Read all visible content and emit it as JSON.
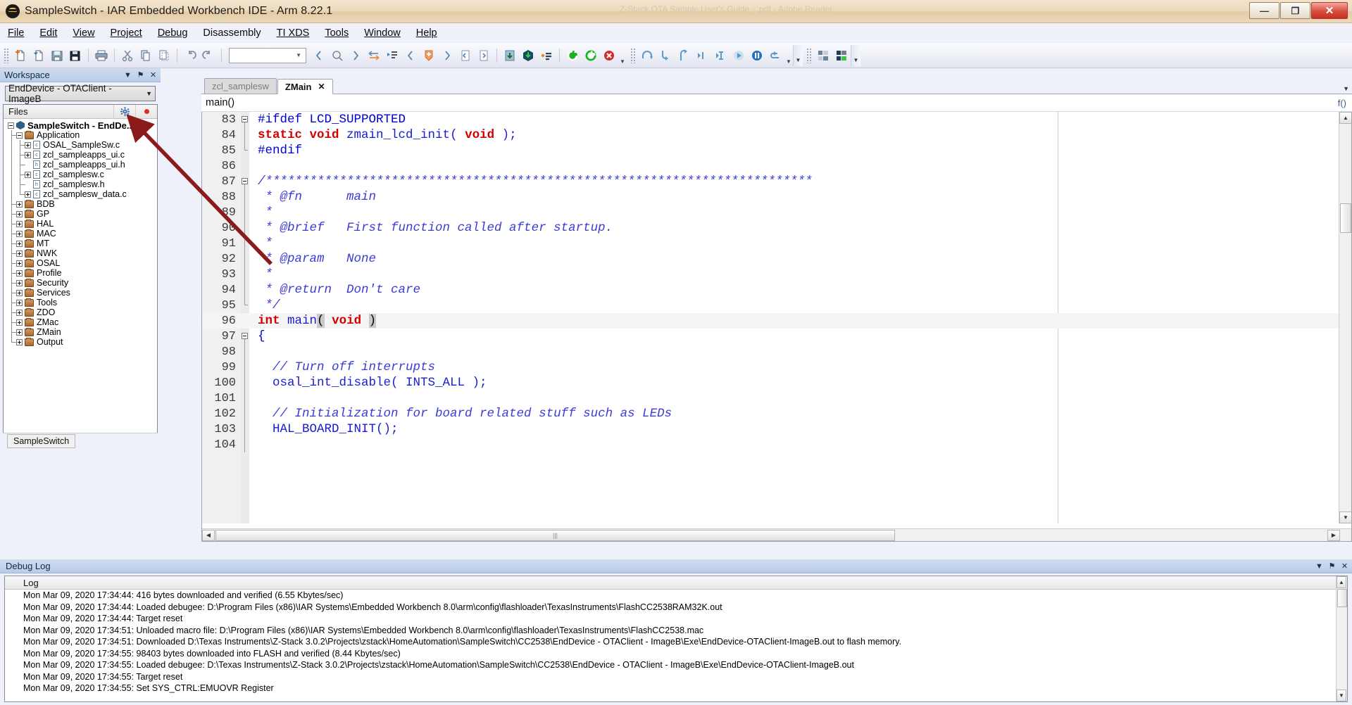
{
  "window": {
    "title": "SampleSwitch - IAR Embedded Workbench IDE - Arm 8.22.1",
    "ghost_title": "Z-Stack OTA Sample User's Guide - .pdf - Adobe Reader",
    "app_icon": "iar-logo-icon",
    "controls": {
      "minimize": "—",
      "maximize": "❐",
      "close": "✕"
    }
  },
  "menubar": {
    "items": [
      {
        "label": "File"
      },
      {
        "label": "Edit"
      },
      {
        "label": "View"
      },
      {
        "label": "Project"
      },
      {
        "label": "Debug"
      },
      {
        "label": "Disassembly"
      },
      {
        "label": "TI XDS"
      },
      {
        "label": "Tools"
      },
      {
        "label": "Window"
      },
      {
        "label": "Help"
      }
    ]
  },
  "toolbar": {
    "combo_value": "",
    "buttons": [
      {
        "name": "new-document-icon"
      },
      {
        "name": "open-document-icon"
      },
      {
        "name": "save-icon"
      },
      {
        "name": "save-all-icon"
      },
      {
        "name": "print-icon"
      },
      {
        "name": "cut-icon"
      },
      {
        "name": "copy-icon"
      },
      {
        "name": "paste-icon"
      },
      {
        "name": "undo-icon"
      },
      {
        "name": "redo-icon"
      },
      {
        "name": "navigate-back-icon"
      },
      {
        "name": "find-icon"
      },
      {
        "name": "navigate-forward-icon"
      },
      {
        "name": "go-to-definition-icon"
      },
      {
        "name": "bookmark-list-icon"
      },
      {
        "name": "previous-bookmark-icon"
      },
      {
        "name": "toggle-bookmark-icon"
      },
      {
        "name": "next-bookmark-icon"
      },
      {
        "name": "compile-icon"
      },
      {
        "name": "make-icon"
      },
      {
        "name": "download-and-debug-icon"
      },
      {
        "name": "debug-without-download-icon"
      },
      {
        "name": "make-and-restart-debugger-icon"
      },
      {
        "name": "reset-icon"
      },
      {
        "name": "stop-debugging-icon"
      },
      {
        "name": "step-over-icon"
      },
      {
        "name": "step-into-icon"
      },
      {
        "name": "step-out-icon"
      },
      {
        "name": "next-statement-icon"
      },
      {
        "name": "run-to-cursor-icon"
      },
      {
        "name": "go-icon"
      },
      {
        "name": "break-icon"
      },
      {
        "name": "reset-target-icon"
      },
      {
        "name": "workspace-layout-icon"
      },
      {
        "name": "workspace-save-layout-icon"
      }
    ]
  },
  "workspace": {
    "title": "Workspace",
    "controls": {
      "dropdown": "▼",
      "pin": "⚑",
      "close": "✕"
    },
    "config": {
      "value": "EndDevice - OTAClient - ImageB",
      "arrow": "▼"
    },
    "files_column": "Files",
    "gear_icon": "gear-icon",
    "dot_icon": "red-dot-icon",
    "status_tab": "SampleSwitch",
    "tree": [
      {
        "label": "SampleSwitch - EndDe...",
        "depth": 0,
        "icon": "project-icon",
        "expander": "minus",
        "bold": true
      },
      {
        "label": "Application",
        "depth": 1,
        "icon": "folder-icon",
        "expander": "minus",
        "bold": false
      },
      {
        "label": "OSAL_SampleSw.c",
        "depth": 2,
        "icon": "c-file-icon",
        "expander": "plus",
        "bold": false
      },
      {
        "label": "zcl_sampleapps_ui.c",
        "depth": 2,
        "icon": "c-file-icon",
        "expander": "plus",
        "bold": false
      },
      {
        "label": "zcl_sampleapps_ui.h",
        "depth": 2,
        "icon": "h-file-icon",
        "expander": "none",
        "bold": false
      },
      {
        "label": "zcl_samplesw.c",
        "depth": 2,
        "icon": "c-file-icon",
        "expander": "plus",
        "bold": false
      },
      {
        "label": "zcl_samplesw.h",
        "depth": 2,
        "icon": "h-file-icon",
        "expander": "none",
        "bold": false
      },
      {
        "label": "zcl_samplesw_data.c",
        "depth": 2,
        "icon": "c-file-icon",
        "expander": "plus",
        "bold": false,
        "last": true
      },
      {
        "label": "BDB",
        "depth": 1,
        "icon": "folder-icon",
        "expander": "plus",
        "bold": false
      },
      {
        "label": "GP",
        "depth": 1,
        "icon": "folder-icon",
        "expander": "plus",
        "bold": false
      },
      {
        "label": "HAL",
        "depth": 1,
        "icon": "folder-icon",
        "expander": "plus",
        "bold": false
      },
      {
        "label": "MAC",
        "depth": 1,
        "icon": "folder-icon",
        "expander": "plus",
        "bold": false
      },
      {
        "label": "MT",
        "depth": 1,
        "icon": "folder-icon",
        "expander": "plus",
        "bold": false
      },
      {
        "label": "NWK",
        "depth": 1,
        "icon": "folder-icon",
        "expander": "plus",
        "bold": false
      },
      {
        "label": "OSAL",
        "depth": 1,
        "icon": "folder-icon",
        "expander": "plus",
        "bold": false
      },
      {
        "label": "Profile",
        "depth": 1,
        "icon": "folder-icon",
        "expander": "plus",
        "bold": false
      },
      {
        "label": "Security",
        "depth": 1,
        "icon": "folder-icon",
        "expander": "plus",
        "bold": false
      },
      {
        "label": "Services",
        "depth": 1,
        "icon": "folder-icon",
        "expander": "plus",
        "bold": false
      },
      {
        "label": "Tools",
        "depth": 1,
        "icon": "folder-icon",
        "expander": "plus",
        "bold": false
      },
      {
        "label": "ZDO",
        "depth": 1,
        "icon": "folder-icon",
        "expander": "plus",
        "bold": false
      },
      {
        "label": "ZMac",
        "depth": 1,
        "icon": "folder-icon",
        "expander": "plus",
        "bold": false
      },
      {
        "label": "ZMain",
        "depth": 1,
        "icon": "folder-icon",
        "expander": "plus",
        "bold": false
      },
      {
        "label": "Output",
        "depth": 1,
        "icon": "folder-icon",
        "expander": "plus",
        "bold": false,
        "last": true
      }
    ]
  },
  "editor": {
    "tabs": [
      {
        "label": "zcl_samplesw",
        "active": false,
        "closable": false
      },
      {
        "label": "ZMain",
        "active": true,
        "closable": true,
        "close_glyph": "✕"
      }
    ],
    "function_bar": "main()",
    "function_bar_right": "f()",
    "first_line_number": 83,
    "lines": [
      {
        "no": 83,
        "fold": "start",
        "tokens": [
          {
            "t": "#ifdef LCD_SUPPORTED",
            "c": "pp"
          }
        ]
      },
      {
        "no": 84,
        "fold": "mid",
        "tokens": [
          {
            "t": "static void ",
            "c": "kw"
          },
          {
            "t": "zmain_lcd_init",
            "c": "ident"
          },
          {
            "t": "( ",
            "c": "ident"
          },
          {
            "t": "void ",
            "c": "kw"
          },
          {
            "t": ");",
            "c": "ident"
          }
        ]
      },
      {
        "no": 85,
        "fold": "end",
        "tokens": [
          {
            "t": "#endif",
            "c": "pp"
          }
        ]
      },
      {
        "no": 86,
        "fold": "none",
        "tokens": [
          {
            "t": "",
            "c": "plain"
          }
        ]
      },
      {
        "no": 87,
        "fold": "start",
        "tokens": [
          {
            "t": "/**************************************************************************",
            "c": "cmt"
          }
        ]
      },
      {
        "no": 88,
        "fold": "mid",
        "tokens": [
          {
            "t": " * @fn      main",
            "c": "cmt"
          }
        ]
      },
      {
        "no": 89,
        "fold": "mid",
        "tokens": [
          {
            "t": " *",
            "c": "cmt"
          }
        ]
      },
      {
        "no": 90,
        "fold": "mid",
        "tokens": [
          {
            "t": " * @brief   First function called after startup.",
            "c": "cmt"
          }
        ]
      },
      {
        "no": 91,
        "fold": "mid",
        "tokens": [
          {
            "t": " *",
            "c": "cmt"
          }
        ]
      },
      {
        "no": 92,
        "fold": "mid",
        "tokens": [
          {
            "t": " * @param   None",
            "c": "cmt"
          }
        ]
      },
      {
        "no": 93,
        "fold": "mid",
        "tokens": [
          {
            "t": " *",
            "c": "cmt"
          }
        ]
      },
      {
        "no": 94,
        "fold": "mid",
        "tokens": [
          {
            "t": " * @return  Don't care",
            "c": "cmt"
          }
        ]
      },
      {
        "no": 95,
        "fold": "end",
        "tokens": [
          {
            "t": " */",
            "c": "cmt"
          }
        ]
      },
      {
        "no": 96,
        "fold": "none",
        "highlight": true,
        "tokens": [
          {
            "t": "int ",
            "c": "kw"
          },
          {
            "t": "main",
            "c": "ident"
          },
          {
            "t": "(",
            "c": "selp"
          },
          {
            "t": " ",
            "c": "plain"
          },
          {
            "t": "void",
            "c": "kw"
          },
          {
            "t": " ",
            "c": "plain"
          },
          {
            "t": ")",
            "c": "selp"
          }
        ]
      },
      {
        "no": 97,
        "fold": "start",
        "tokens": [
          {
            "t": "{",
            "c": "pp"
          }
        ]
      },
      {
        "no": 98,
        "fold": "mid",
        "tokens": [
          {
            "t": "",
            "c": "plain"
          }
        ]
      },
      {
        "no": 99,
        "fold": "mid",
        "tokens": [
          {
            "t": "  // Turn off interrupts",
            "c": "cmt"
          }
        ]
      },
      {
        "no": 100,
        "fold": "mid",
        "tokens": [
          {
            "t": "  osal_int_disable( INTS_ALL );",
            "c": "ident"
          }
        ]
      },
      {
        "no": 101,
        "fold": "mid",
        "tokens": [
          {
            "t": "",
            "c": "plain"
          }
        ]
      },
      {
        "no": 102,
        "fold": "mid",
        "tokens": [
          {
            "t": "  // Initialization for board related stuff such as LEDs",
            "c": "cmt"
          }
        ]
      },
      {
        "no": 103,
        "fold": "mid",
        "tokens": [
          {
            "t": "  HAL_BOARD_INIT();",
            "c": "ident"
          }
        ]
      },
      {
        "no": 104,
        "fold": "mid",
        "tokens": [
          {
            "t": "",
            "c": "plain"
          }
        ]
      }
    ],
    "hscroll_grip": "|||"
  },
  "debug_log": {
    "title": "Debug Log",
    "controls": {
      "dropdown": "▼",
      "pin": "⚑",
      "close": "✕"
    },
    "column_header": "Log",
    "entries": [
      "Mon Mar 09, 2020 17:34:44: 416 bytes downloaded and verified (6.55 Kbytes/sec)",
      "Mon Mar 09, 2020 17:34:44: Loaded debugee: D:\\Program Files (x86)\\IAR Systems\\Embedded Workbench 8.0\\arm\\config\\flashloader\\TexasInstruments\\FlashCC2538RAM32K.out",
      "Mon Mar 09, 2020 17:34:44: Target reset",
      "Mon Mar 09, 2020 17:34:51: Unloaded macro file: D:\\Program Files (x86)\\IAR Systems\\Embedded Workbench 8.0\\arm\\config\\flashloader\\TexasInstruments\\FlashCC2538.mac",
      "Mon Mar 09, 2020 17:34:51: Downloaded D:\\Texas Instruments\\Z-Stack 3.0.2\\Projects\\zstack\\HomeAutomation\\SampleSwitch\\CC2538\\EndDevice - OTAClient - ImageB\\Exe\\EndDevice-OTAClient-ImageB.out to flash memory.",
      "Mon Mar 09, 2020 17:34:55: 98403 bytes downloaded into FLASH and verified (8.44 Kbytes/sec)",
      "Mon Mar 09, 2020 17:34:55: Loaded debugee: D:\\Texas Instruments\\Z-Stack 3.0.2\\Projects\\zstack\\HomeAutomation\\SampleSwitch\\CC2538\\EndDevice - OTAClient - ImageB\\Exe\\EndDevice-OTAClient-ImageB.out",
      "Mon Mar 09, 2020 17:34:55: Target reset",
      "Mon Mar 09, 2020 17:34:55: Set SYS_CTRL:EMUOVR Register"
    ]
  },
  "annotation": {
    "arrow_color": "#8b1a1a",
    "description": "red-arrow-pointing-to-config-dropdown"
  }
}
